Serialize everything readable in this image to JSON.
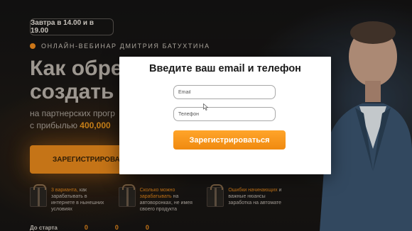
{
  "background": {
    "date_pill": "Завтра в 14.00 и в 19.00",
    "webinar_label": "ОНЛАЙН-ВЕБИНАР ДМИТРИЯ БАТУХТИНА",
    "headline_line1": "Как обре",
    "headline_line2": "создать с",
    "sub_line1": "на партнерских прогр",
    "sub_line2_prefix": "с прибылью ",
    "sub_line2_amount": "400,000",
    "cta_label": "ЗАРЕГИСТРИРОВАТ",
    "features": [
      {
        "accent": "3 варианта,",
        "text": "как зарабатывать в интернете в нынешних условиях"
      },
      {
        "accent": "Сколько можно зарабатывать",
        "text": "на автоворонках, не имея своего продукта"
      },
      {
        "accent": "Ошибки начинающих",
        "text": "и важные нюансы заработка на автомате"
      }
    ],
    "countdown_label": "До старта",
    "countdown_values": [
      "0",
      "0",
      "0"
    ]
  },
  "modal": {
    "title": "Введите ваш email и телефон",
    "email_placeholder": "Email",
    "phone_placeholder": "Телефон",
    "submit_label": "Зарегистрироваться"
  },
  "colors": {
    "accent": "#f08a10",
    "modal_bg": "#ffffff",
    "page_bg": "#1a1816"
  },
  "icons": [
    "gift-icon",
    "cursor-icon",
    "status-dot-icon"
  ]
}
